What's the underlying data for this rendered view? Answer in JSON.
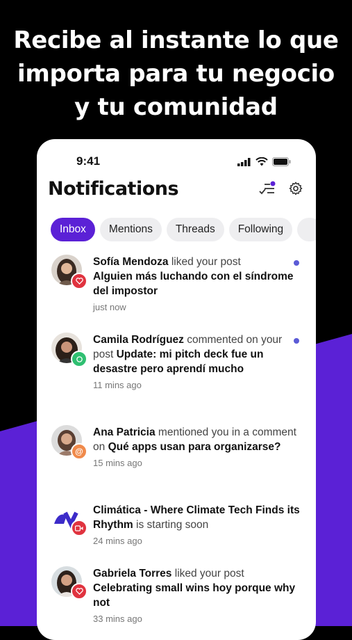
{
  "headline": {
    "line1": "Recibe al instante lo que",
    "line2": "importa para tu negocio",
    "line3": "y tu comunidad"
  },
  "status_bar": {
    "time": "9:41"
  },
  "header": {
    "title": "Notifications",
    "filter_icon": "mark-read-icon",
    "settings_icon": "gear-icon"
  },
  "tabs": [
    {
      "label": "Inbox",
      "active": true
    },
    {
      "label": "Mentions"
    },
    {
      "label": "Threads"
    },
    {
      "label": "Following"
    }
  ],
  "notifications": [
    {
      "name": "Sofía Mendoza",
      "action": " liked your post",
      "post": "Alguien más luchando con el síndrome del impostor",
      "time": "just now",
      "badge": "heart",
      "unread": true
    },
    {
      "name": "Camila Rodríguez",
      "action": " commented on your post ",
      "post": "Update: mi pitch deck fue un desastre pero aprendí mucho",
      "time": "11 mins ago",
      "badge": "comment",
      "unread": true
    },
    {
      "name": "Ana Patricia",
      "action": " mentioned you in a comment on ",
      "post": "Qué apps usan para organizarse?",
      "time": "15 mins ago",
      "badge": "mention",
      "unread": false
    },
    {
      "name": "Climática - Where Climate Tech Finds its Rhythm",
      "action": " is starting soon",
      "post": "",
      "time": "24 mins ago",
      "badge": "video",
      "unread": false
    },
    {
      "name": "Gabriela Torres",
      "action": " liked your post ",
      "post": "Celebrating small wins hoy porque why not",
      "time": "33 mins ago",
      "badge": "heart",
      "unread": false
    }
  ],
  "colors": {
    "accent": "#5b21d6",
    "heart_badge": "#e0333f",
    "comment_badge": "#2fbf71",
    "mention_badge": "#f08a4b"
  }
}
